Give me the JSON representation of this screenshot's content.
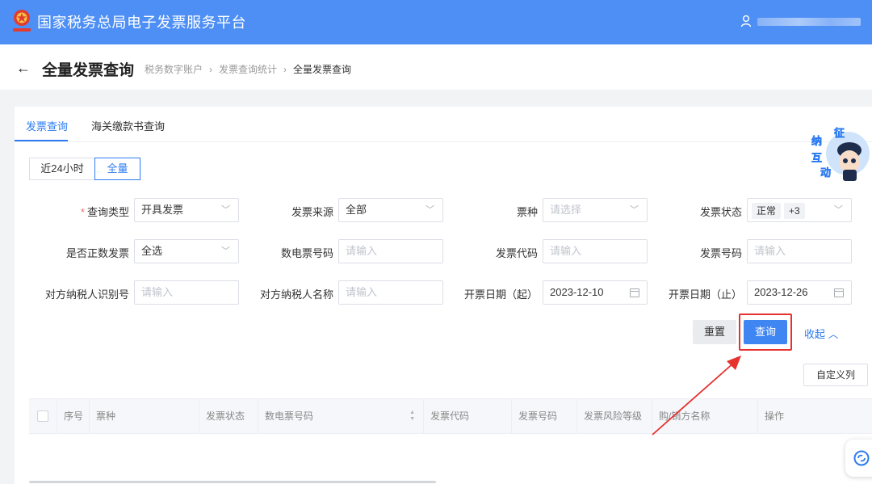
{
  "header": {
    "app_title": "国家税务总局电子发票服务平台"
  },
  "page": {
    "title": "全量发票查询",
    "breadcrumb": [
      "税务数字账户",
      "发票查询统计",
      "全量发票查询"
    ]
  },
  "tabs": [
    "发票查询",
    "海关缴款书查询"
  ],
  "range_toggle": [
    "近24小时",
    "全量"
  ],
  "form": {
    "query_type": {
      "label": "查询类型",
      "value": "开具发票"
    },
    "invoice_source": {
      "label": "发票来源",
      "value": "全部"
    },
    "ticket_type": {
      "label": "票种",
      "placeholder": "请选择"
    },
    "invoice_status": {
      "label": "发票状态",
      "tag": "正常",
      "more": "+3"
    },
    "is_positive": {
      "label": "是否正数发票",
      "value": "全选"
    },
    "digital_no": {
      "label": "数电票号码",
      "placeholder": "请输入"
    },
    "invoice_code": {
      "label": "发票代码",
      "placeholder": "请输入"
    },
    "invoice_no": {
      "label": "发票号码",
      "placeholder": "请输入"
    },
    "counterparty_id": {
      "label": "对方纳税人识别号",
      "placeholder": "请输入"
    },
    "counterparty_name": {
      "label": "对方纳税人名称",
      "placeholder": "请输入"
    },
    "date_start": {
      "label": "开票日期（起）",
      "value": "2023-12-10"
    },
    "date_end": {
      "label": "开票日期（止）",
      "value": "2023-12-26"
    }
  },
  "actions": {
    "reset": "重置",
    "query": "查询",
    "collapse": "收起",
    "custom_columns": "自定义列"
  },
  "table": {
    "columns": [
      "序号",
      "票种",
      "发票状态",
      "数电票号码",
      "发票代码",
      "发票号码",
      "发票风险等级",
      "购/销方名称",
      "操作"
    ]
  },
  "mascot": {
    "text": [
      "征",
      "纳",
      "互",
      "动"
    ]
  },
  "colors": {
    "brand": "#4d8ff5",
    "primary": "#2d7cf1",
    "highlight": "#e6322e"
  }
}
